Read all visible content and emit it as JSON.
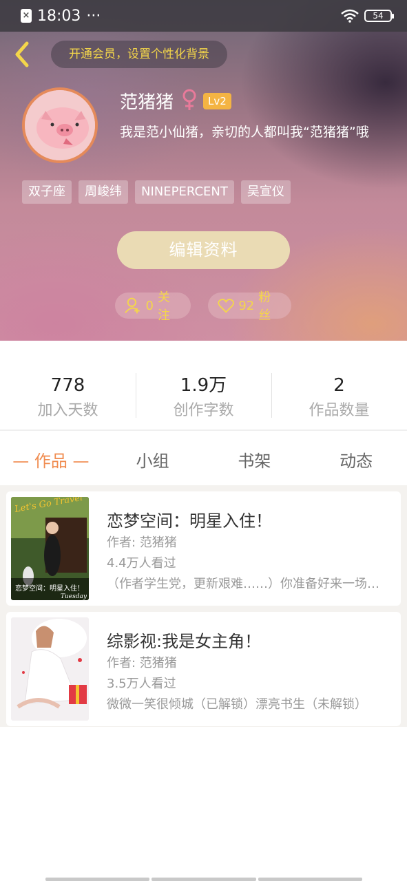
{
  "status_bar": {
    "time": "18:03",
    "dots": "···",
    "battery": "54"
  },
  "header": {
    "vip_banner": "开通会员，设置个性化背景",
    "username": "范猪猪",
    "level": "Lv2",
    "bio": "我是范小仙猪，亲切的人都叫我“范猪猪”哦",
    "tags": [
      "双子座",
      "周峻纬",
      "NINEPERCENT",
      "吴宣仪"
    ],
    "edit_button": "编辑资料",
    "following_count": "0",
    "following_label": "关注",
    "fans_count": "92",
    "fans_label": "粉丝"
  },
  "stats": [
    {
      "value": "778",
      "label": "加入天数"
    },
    {
      "value": "1.9万",
      "label": "创作字数"
    },
    {
      "value": "2",
      "label": "作品数量"
    }
  ],
  "tabs": [
    {
      "label": "— 作品 —",
      "active": true
    },
    {
      "label": "小组",
      "active": false
    },
    {
      "label": "书架",
      "active": false
    },
    {
      "label": "动态",
      "active": false
    }
  ],
  "works": [
    {
      "title": "恋梦空间：明星入住！",
      "author": "作者: 范猪猪",
      "views": "4.4万人看过",
      "desc": "（作者学生党，更新艰难……）你准备好来一场恋梦之旅了吗？",
      "cover_text": "恋梦空间：明星入住！",
      "cover_script": "Let's Go Travel",
      "cover_tag": "Tuesday"
    },
    {
      "title": "综影视:我是女主角！",
      "author": "作者: 范猪猪",
      "views": "3.5万人看过",
      "desc": "微微一笑很倾城（已解锁）漂亮书生（未解锁）"
    }
  ],
  "colors": {
    "accent": "#f08c50",
    "vip_text": "#f4d64a",
    "level_badge": "#f4b443",
    "edit_button": "#eadbb4"
  }
}
